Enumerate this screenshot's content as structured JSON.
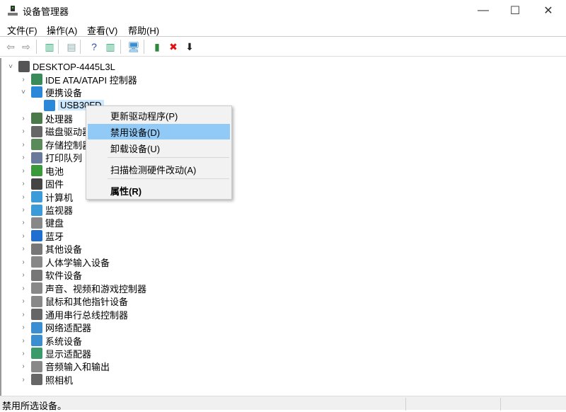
{
  "window": {
    "title": "设备管理器",
    "minimize": "—",
    "maximize": "☐",
    "close": "✕"
  },
  "menu": [
    "文件(F)",
    "操作(A)",
    "查看(V)",
    "帮助(H)"
  ],
  "toolbar": [
    {
      "name": "back-icon",
      "glyph": "⇦",
      "color": "#888"
    },
    {
      "name": "forward-icon",
      "glyph": "⇨",
      "color": "#888"
    },
    {
      "name": "show-hide-console-tree-icon",
      "glyph": "▥",
      "color": "#3a7"
    },
    {
      "name": "properties-icon",
      "glyph": "▤",
      "color": "#8aa"
    },
    {
      "name": "help-icon",
      "glyph": "?",
      "color": "#2a4fb0"
    },
    {
      "name": "show-action-pane-icon",
      "glyph": "▥",
      "color": "#3a7"
    },
    {
      "name": "scan-hardware-icon",
      "glyph": "🖥",
      "color": "#3b8fd0"
    },
    {
      "name": "update-driver-icon",
      "glyph": "▮",
      "color": "#2a8a3a"
    },
    {
      "name": "uninstall-icon",
      "glyph": "✖",
      "color": "#e01010"
    },
    {
      "name": "disable-icon",
      "glyph": "⬇",
      "color": "#222"
    }
  ],
  "tree": {
    "root": "DESKTOP-4445L3L",
    "items": [
      {
        "label": "IDE ATA/ATAPI 控制器",
        "expanded": false,
        "color": "#3a8a5a"
      },
      {
        "label": "便携设备",
        "expanded": true,
        "color": "#2b88d8"
      },
      {
        "label": "USB30FD",
        "child": true,
        "selected": true,
        "color": "#2b88d8"
      },
      {
        "label": "处理器",
        "expanded": false,
        "color": "#4a7a4a"
      },
      {
        "label": "磁盘驱动器",
        "expanded": false,
        "color": "#666"
      },
      {
        "label": "存储控制器",
        "expanded": false,
        "color": "#5a8a5a"
      },
      {
        "label": "打印队列",
        "expanded": false,
        "color": "#6a7a9a"
      },
      {
        "label": "电池",
        "expanded": false,
        "color": "#3a9a3a"
      },
      {
        "label": "固件",
        "expanded": false,
        "color": "#444"
      },
      {
        "label": "计算机",
        "expanded": false,
        "color": "#3b9ad8"
      },
      {
        "label": "监视器",
        "expanded": false,
        "color": "#3b9ad8"
      },
      {
        "label": "键盘",
        "expanded": false,
        "color": "#888"
      },
      {
        "label": "蓝牙",
        "expanded": false,
        "color": "#1f6fd0"
      },
      {
        "label": "其他设备",
        "expanded": false,
        "color": "#777"
      },
      {
        "label": "人体学输入设备",
        "expanded": false,
        "color": "#888"
      },
      {
        "label": "软件设备",
        "expanded": false,
        "color": "#777"
      },
      {
        "label": "声音、视频和游戏控制器",
        "expanded": false,
        "color": "#888"
      },
      {
        "label": "鼠标和其他指针设备",
        "expanded": false,
        "color": "#888"
      },
      {
        "label": "通用串行总线控制器",
        "expanded": false,
        "color": "#666"
      },
      {
        "label": "网络适配器",
        "expanded": false,
        "color": "#3b8fd0"
      },
      {
        "label": "系统设备",
        "expanded": false,
        "color": "#3b8fd0"
      },
      {
        "label": "显示适配器",
        "expanded": false,
        "color": "#3a9a6a"
      },
      {
        "label": "音频输入和输出",
        "expanded": false,
        "color": "#888"
      },
      {
        "label": "照相机",
        "expanded": false,
        "color": "#666"
      }
    ]
  },
  "context_menu": {
    "items": [
      "更新驱动程序(P)",
      "禁用设备(D)",
      "卸载设备(U)",
      "扫描检测硬件改动(A)",
      "属性(R)"
    ],
    "highlighted": 1
  },
  "status": {
    "text": "禁用所选设备。"
  }
}
